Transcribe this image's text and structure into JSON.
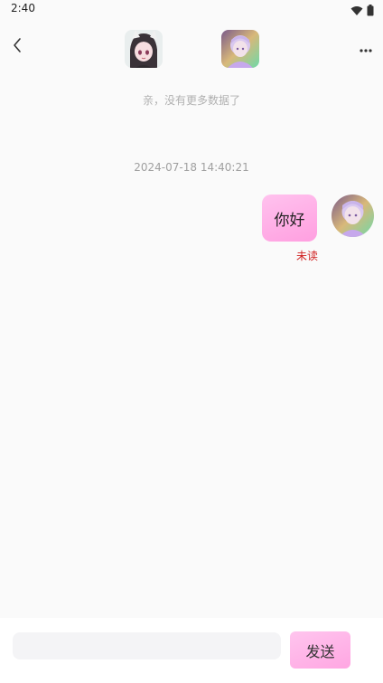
{
  "status_bar": {
    "time": "2:40",
    "icons": [
      "wifi-icon",
      "battery-icon"
    ]
  },
  "header": {
    "back_icon": "chevron-left-icon",
    "more_icon": "more-dots-icon",
    "avatars": [
      "contact-avatar",
      "self-avatar"
    ]
  },
  "chat": {
    "no_more_text": "亲，没有更多数据了",
    "timestamp": "2024-07-18 14:40:21",
    "messages": [
      {
        "text": "你好",
        "status": "未读",
        "from": "self"
      }
    ]
  },
  "composer": {
    "input_value": "",
    "input_placeholder": "",
    "send_label": "发送"
  },
  "colors": {
    "bubble": "#ffb0e8",
    "send_button": "#ffb4e6",
    "unread_text": "#d02020",
    "background": "#fafafa"
  }
}
